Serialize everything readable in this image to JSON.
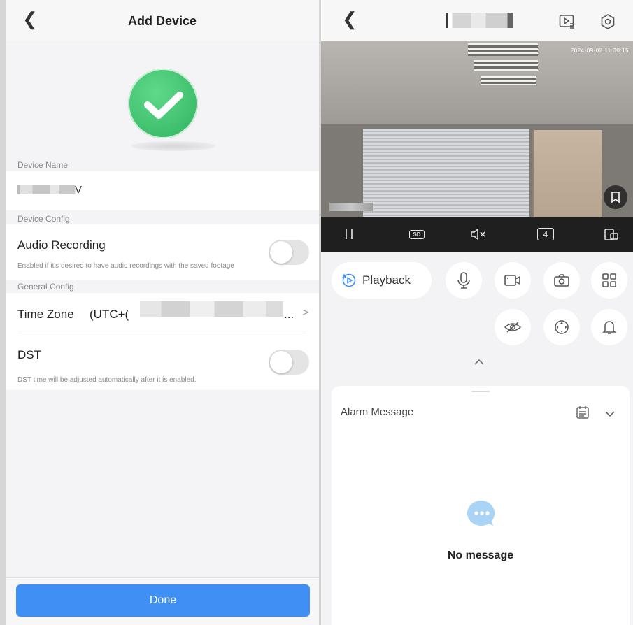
{
  "left_panel": {
    "header": {
      "title": "Add Device"
    },
    "device_name_label": "Device Name",
    "device_name_value_tail": "V",
    "device_config_label": "Device Config",
    "audio_recording": {
      "title": "Audio Recording",
      "description": "Enabled if it's desired to have audio recordings with the saved footage",
      "enabled": false
    },
    "general_config_label": "General Config",
    "time_zone": {
      "label": "Time Zone",
      "value_prefix": "(UTC+(",
      "value_suffix": "...",
      "chevron": ">"
    },
    "dst": {
      "title": "DST",
      "description": "DST time will be adjusted automatically after it is enabled.",
      "enabled": false
    },
    "done_label": "Done"
  },
  "right_panel": {
    "header": {
      "icons": [
        "playback-list-icon",
        "settings-icon"
      ]
    },
    "video": {
      "timestamp": "2024-09-02 11:30:15"
    },
    "control_bar": {
      "quality_label": "SD",
      "channel_count": "4"
    },
    "playback_label": "Playback",
    "alarm": {
      "title": "Alarm Message",
      "empty_text": "No message"
    },
    "colors": {
      "accent": "#3f8ff5",
      "success": "#34b865",
      "bubble": "#a9d4f5"
    }
  }
}
